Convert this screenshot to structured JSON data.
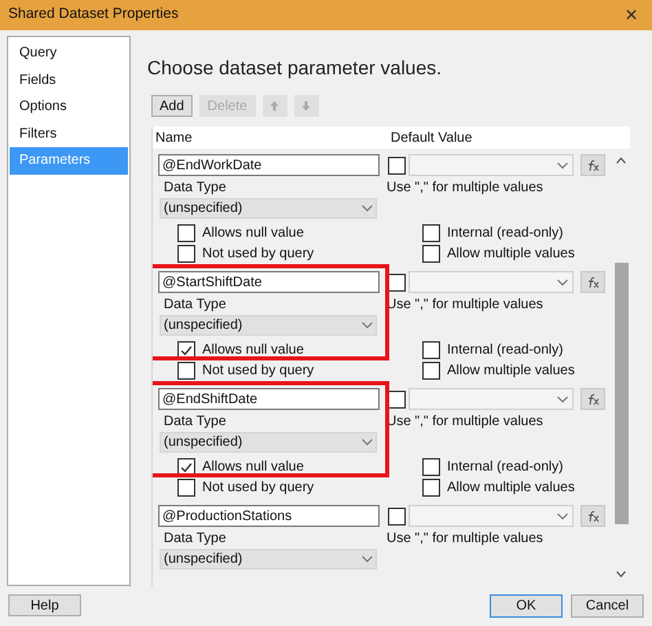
{
  "window": {
    "title": "Shared Dataset Properties",
    "close": "✕"
  },
  "sidebar": {
    "items": [
      {
        "label": "Query",
        "selected": false
      },
      {
        "label": "Fields",
        "selected": false
      },
      {
        "label": "Options",
        "selected": false
      },
      {
        "label": "Filters",
        "selected": false
      },
      {
        "label": "Parameters",
        "selected": true
      }
    ]
  },
  "heading": "Choose dataset parameter values.",
  "toolbar": [
    {
      "kind": "text",
      "label": "Add",
      "disabled": false
    },
    {
      "kind": "text",
      "label": "Delete",
      "disabled": true
    },
    {
      "kind": "up",
      "disabled": true
    },
    {
      "kind": "down",
      "disabled": true
    }
  ],
  "grid": {
    "columns": [
      "Name",
      "Default Value"
    ],
    "parameters": [
      {
        "name": "@EndWorkDate",
        "highlighted": false,
        "default_checked": false,
        "hint": "Use \",\" for multiple values",
        "data_type_label": "Data Type",
        "data_type": "(unspecified)",
        "options": [
          {
            "label": "Allows null value",
            "checked": false
          },
          {
            "label": "Internal (read-only)",
            "checked": false
          },
          {
            "label": "Not used by query",
            "checked": false
          },
          {
            "label": "Allow multiple values",
            "checked": false
          }
        ]
      },
      {
        "name": "@StartShiftDate",
        "highlighted": true,
        "default_checked": false,
        "hint": "Use \",\" for multiple values",
        "data_type_label": "Data Type",
        "data_type": "(unspecified)",
        "options": [
          {
            "label": "Allows null value",
            "checked": true
          },
          {
            "label": "Internal (read-only)",
            "checked": false
          },
          {
            "label": "Not used by query",
            "checked": false
          },
          {
            "label": "Allow multiple values",
            "checked": false
          }
        ]
      },
      {
        "name": "@EndShiftDate",
        "highlighted": true,
        "default_checked": false,
        "hint": "Use \",\" for multiple values",
        "data_type_label": "Data Type",
        "data_type": "(unspecified)",
        "options": [
          {
            "label": "Allows null value",
            "checked": true
          },
          {
            "label": "Internal (read-only)",
            "checked": false
          },
          {
            "label": "Not used by query",
            "checked": false
          },
          {
            "label": "Allow multiple values",
            "checked": false
          }
        ]
      },
      {
        "name": "@ProductionStations",
        "highlighted": false,
        "default_checked": false,
        "hint": "Use \",\" for multiple values",
        "data_type_label": "Data Type",
        "data_type": "(unspecified)"
      }
    ]
  },
  "footer": {
    "help": "Help",
    "ok": "OK",
    "cancel": "Cancel"
  }
}
